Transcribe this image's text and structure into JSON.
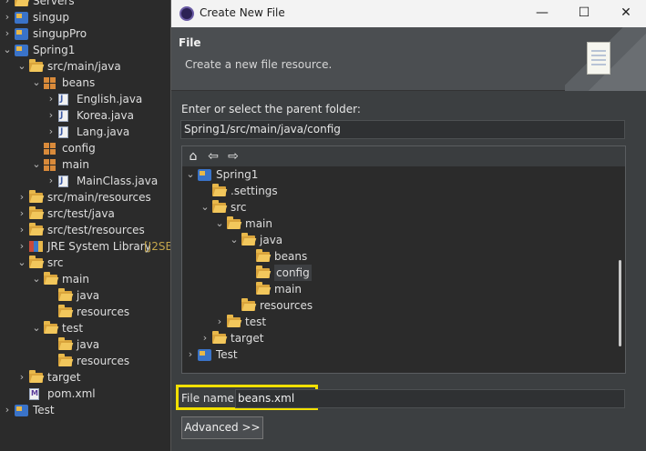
{
  "explorer": {
    "items": [
      {
        "label": "Servers",
        "indent": 0,
        "twisty": ">",
        "icon": "folder-icon"
      },
      {
        "label": "singup",
        "indent": 0,
        "twisty": ">",
        "icon": "project-icon"
      },
      {
        "label": "singupPro",
        "indent": 0,
        "twisty": ">",
        "icon": "project-icon"
      },
      {
        "label": "Spring1",
        "indent": 0,
        "twisty": "v",
        "icon": "project-icon"
      },
      {
        "label": "src/main/java",
        "indent": 1,
        "twisty": "v",
        "icon": "source-folder-icon"
      },
      {
        "label": "beans",
        "indent": 2,
        "twisty": "v",
        "icon": "package-icon"
      },
      {
        "label": "English.java",
        "indent": 3,
        "twisty": ">",
        "icon": "java-file-icon"
      },
      {
        "label": "Korea.java",
        "indent": 3,
        "twisty": ">",
        "icon": "java-file-icon"
      },
      {
        "label": "Lang.java",
        "indent": 3,
        "twisty": ">",
        "icon": "java-file-icon"
      },
      {
        "label": "config",
        "indent": 2,
        "twisty": "",
        "icon": "package-icon"
      },
      {
        "label": "main",
        "indent": 2,
        "twisty": "v",
        "icon": "package-icon"
      },
      {
        "label": "MainClass.java",
        "indent": 3,
        "twisty": ">",
        "icon": "java-file-icon"
      },
      {
        "label": "src/main/resources",
        "indent": 1,
        "twisty": ">",
        "icon": "source-folder-icon"
      },
      {
        "label": "src/test/java",
        "indent": 1,
        "twisty": ">",
        "icon": "source-folder-icon"
      },
      {
        "label": "src/test/resources",
        "indent": 1,
        "twisty": ">",
        "icon": "source-folder-icon"
      },
      {
        "label": "JRE System Library",
        "suffix": "[J2SE",
        "indent": 1,
        "twisty": ">",
        "icon": "library-icon"
      },
      {
        "label": "src",
        "indent": 1,
        "twisty": "v",
        "icon": "folder-icon"
      },
      {
        "label": "main",
        "indent": 2,
        "twisty": "v",
        "icon": "folder-icon"
      },
      {
        "label": "java",
        "indent": 3,
        "twisty": "",
        "icon": "folder-icon"
      },
      {
        "label": "resources",
        "indent": 3,
        "twisty": "",
        "icon": "folder-icon"
      },
      {
        "label": "test",
        "indent": 2,
        "twisty": "v",
        "icon": "folder-icon"
      },
      {
        "label": "java",
        "indent": 3,
        "twisty": "",
        "icon": "folder-icon"
      },
      {
        "label": "resources",
        "indent": 3,
        "twisty": "",
        "icon": "folder-icon"
      },
      {
        "label": "target",
        "indent": 1,
        "twisty": ">",
        "icon": "folder-icon"
      },
      {
        "label": "pom.xml",
        "indent": 1,
        "twisty": "",
        "icon": "xml-file-icon"
      },
      {
        "label": "Test",
        "indent": 0,
        "twisty": ">",
        "icon": "project-icon"
      }
    ]
  },
  "dialog": {
    "title": "Create New File",
    "controls": {
      "minimize": "—",
      "maximize": "☐",
      "close": "✕"
    },
    "banner": {
      "title": "File",
      "description": "Create a new file resource."
    },
    "parent_label": "Enter or select the parent folder:",
    "parent_value": "Spring1/src/main/java/config",
    "nav": {
      "home": "⌂",
      "back": "⇦",
      "forward": "⇨"
    },
    "tree": [
      {
        "label": "Spring1",
        "indent": 0,
        "twisty": "v",
        "icon": "project-icon"
      },
      {
        "label": ".settings",
        "indent": 1,
        "twisty": "",
        "icon": "folder-icon"
      },
      {
        "label": "src",
        "indent": 1,
        "twisty": "v",
        "icon": "folder-icon"
      },
      {
        "label": "main",
        "indent": 2,
        "twisty": "v",
        "icon": "folder-icon"
      },
      {
        "label": "java",
        "indent": 3,
        "twisty": "v",
        "icon": "folder-icon"
      },
      {
        "label": "beans",
        "indent": 4,
        "twisty": "",
        "icon": "folder-icon"
      },
      {
        "label": "config",
        "indent": 4,
        "twisty": "",
        "icon": "folder-icon",
        "selected": true
      },
      {
        "label": "main",
        "indent": 4,
        "twisty": "",
        "icon": "folder-icon"
      },
      {
        "label": "resources",
        "indent": 3,
        "twisty": "",
        "icon": "folder-icon"
      },
      {
        "label": "test",
        "indent": 2,
        "twisty": ">",
        "icon": "folder-icon"
      },
      {
        "label": "target",
        "indent": 1,
        "twisty": ">",
        "icon": "folder-icon"
      },
      {
        "label": "Test",
        "indent": 0,
        "twisty": ">",
        "icon": "project-icon"
      }
    ],
    "file_name_label": "File name:",
    "file_name_value": "beans.xml",
    "advanced_button": "Advanced >>"
  },
  "colors": {
    "highlight": "#f2e000",
    "dialog_bg": "#3c3f41",
    "explorer_bg": "#2b2b2b"
  }
}
